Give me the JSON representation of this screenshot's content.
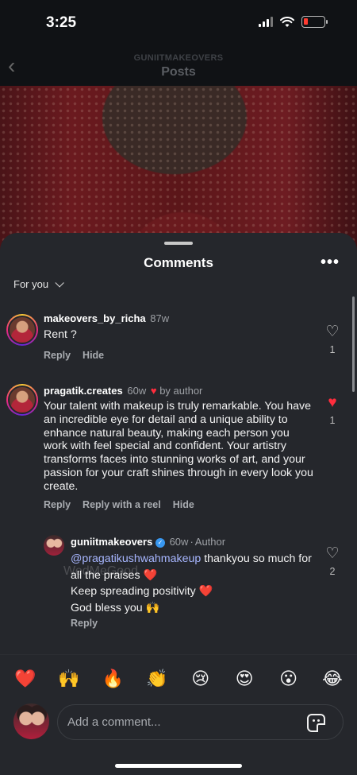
{
  "status_bar": {
    "time": "3:25",
    "battery_level": 0.12
  },
  "nav": {
    "username": "GUNIITMAKEOVERS",
    "title": "Posts"
  },
  "sheet": {
    "title": "Comments",
    "filter_label": "For you"
  },
  "comments": [
    {
      "username": "makeovers_by_richa",
      "time": "87w",
      "text": "Rent ?",
      "actions": [
        "Reply",
        "Hide"
      ],
      "likes": "1",
      "liked": false
    },
    {
      "username": "pragatik.creates",
      "time": "60w",
      "by_author_label": "by author",
      "text": "Your talent with makeup is truly remarkable. You have an incredible eye for detail and a unique ability to enhance natural beauty, making each person you work with feel special and confident. Your artistry transforms faces into stunning works of art, and your passion for your craft shines through in every look you create.",
      "actions": [
        "Reply",
        "Reply with a reel",
        "Hide"
      ],
      "likes": "1",
      "liked": true
    },
    {
      "username": "guniitmakeovers",
      "time": "60w",
      "role": "Author",
      "mention": "@pragatikushwahmakeup",
      "line1": " thankyou so much for all the praises",
      "line2": "Keep spreading positivity",
      "line3": "God bless you",
      "actions": [
        "Reply"
      ],
      "likes": "2",
      "liked": false
    }
  ],
  "watermark": "WedMeGood",
  "emojis": [
    "❤️",
    "🙌",
    "🔥",
    "👏",
    "😢",
    "😍",
    "😮",
    "😂"
  ],
  "composer": {
    "placeholder": "Add a comment..."
  },
  "colors": {
    "sheet_bg": "#25272c",
    "like_red": "#ff2d3d",
    "mention_blue": "#a7b6ff"
  }
}
